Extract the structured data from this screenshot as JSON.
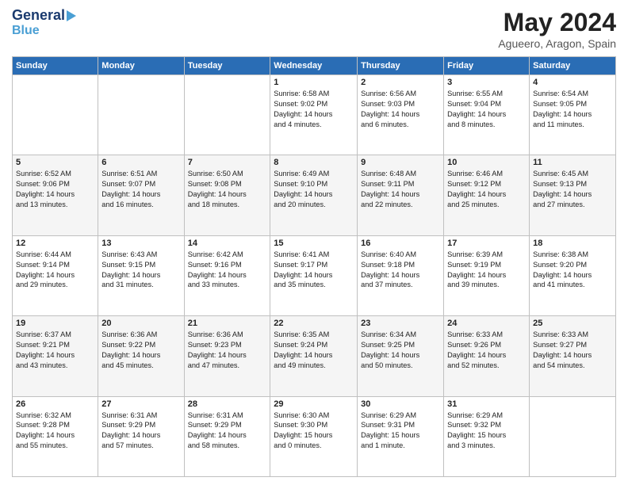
{
  "header": {
    "logo_line1": "General",
    "logo_line2": "Blue",
    "month": "May 2024",
    "location": "Agueero, Aragon, Spain"
  },
  "weekdays": [
    "Sunday",
    "Monday",
    "Tuesday",
    "Wednesday",
    "Thursday",
    "Friday",
    "Saturday"
  ],
  "weeks": [
    [
      {
        "day": "",
        "info": ""
      },
      {
        "day": "",
        "info": ""
      },
      {
        "day": "",
        "info": ""
      },
      {
        "day": "1",
        "info": "Sunrise: 6:58 AM\nSunset: 9:02 PM\nDaylight: 14 hours\nand 4 minutes."
      },
      {
        "day": "2",
        "info": "Sunrise: 6:56 AM\nSunset: 9:03 PM\nDaylight: 14 hours\nand 6 minutes."
      },
      {
        "day": "3",
        "info": "Sunrise: 6:55 AM\nSunset: 9:04 PM\nDaylight: 14 hours\nand 8 minutes."
      },
      {
        "day": "4",
        "info": "Sunrise: 6:54 AM\nSunset: 9:05 PM\nDaylight: 14 hours\nand 11 minutes."
      }
    ],
    [
      {
        "day": "5",
        "info": "Sunrise: 6:52 AM\nSunset: 9:06 PM\nDaylight: 14 hours\nand 13 minutes."
      },
      {
        "day": "6",
        "info": "Sunrise: 6:51 AM\nSunset: 9:07 PM\nDaylight: 14 hours\nand 16 minutes."
      },
      {
        "day": "7",
        "info": "Sunrise: 6:50 AM\nSunset: 9:08 PM\nDaylight: 14 hours\nand 18 minutes."
      },
      {
        "day": "8",
        "info": "Sunrise: 6:49 AM\nSunset: 9:10 PM\nDaylight: 14 hours\nand 20 minutes."
      },
      {
        "day": "9",
        "info": "Sunrise: 6:48 AM\nSunset: 9:11 PM\nDaylight: 14 hours\nand 22 minutes."
      },
      {
        "day": "10",
        "info": "Sunrise: 6:46 AM\nSunset: 9:12 PM\nDaylight: 14 hours\nand 25 minutes."
      },
      {
        "day": "11",
        "info": "Sunrise: 6:45 AM\nSunset: 9:13 PM\nDaylight: 14 hours\nand 27 minutes."
      }
    ],
    [
      {
        "day": "12",
        "info": "Sunrise: 6:44 AM\nSunset: 9:14 PM\nDaylight: 14 hours\nand 29 minutes."
      },
      {
        "day": "13",
        "info": "Sunrise: 6:43 AM\nSunset: 9:15 PM\nDaylight: 14 hours\nand 31 minutes."
      },
      {
        "day": "14",
        "info": "Sunrise: 6:42 AM\nSunset: 9:16 PM\nDaylight: 14 hours\nand 33 minutes."
      },
      {
        "day": "15",
        "info": "Sunrise: 6:41 AM\nSunset: 9:17 PM\nDaylight: 14 hours\nand 35 minutes."
      },
      {
        "day": "16",
        "info": "Sunrise: 6:40 AM\nSunset: 9:18 PM\nDaylight: 14 hours\nand 37 minutes."
      },
      {
        "day": "17",
        "info": "Sunrise: 6:39 AM\nSunset: 9:19 PM\nDaylight: 14 hours\nand 39 minutes."
      },
      {
        "day": "18",
        "info": "Sunrise: 6:38 AM\nSunset: 9:20 PM\nDaylight: 14 hours\nand 41 minutes."
      }
    ],
    [
      {
        "day": "19",
        "info": "Sunrise: 6:37 AM\nSunset: 9:21 PM\nDaylight: 14 hours\nand 43 minutes."
      },
      {
        "day": "20",
        "info": "Sunrise: 6:36 AM\nSunset: 9:22 PM\nDaylight: 14 hours\nand 45 minutes."
      },
      {
        "day": "21",
        "info": "Sunrise: 6:36 AM\nSunset: 9:23 PM\nDaylight: 14 hours\nand 47 minutes."
      },
      {
        "day": "22",
        "info": "Sunrise: 6:35 AM\nSunset: 9:24 PM\nDaylight: 14 hours\nand 49 minutes."
      },
      {
        "day": "23",
        "info": "Sunrise: 6:34 AM\nSunset: 9:25 PM\nDaylight: 14 hours\nand 50 minutes."
      },
      {
        "day": "24",
        "info": "Sunrise: 6:33 AM\nSunset: 9:26 PM\nDaylight: 14 hours\nand 52 minutes."
      },
      {
        "day": "25",
        "info": "Sunrise: 6:33 AM\nSunset: 9:27 PM\nDaylight: 14 hours\nand 54 minutes."
      }
    ],
    [
      {
        "day": "26",
        "info": "Sunrise: 6:32 AM\nSunset: 9:28 PM\nDaylight: 14 hours\nand 55 minutes."
      },
      {
        "day": "27",
        "info": "Sunrise: 6:31 AM\nSunset: 9:29 PM\nDaylight: 14 hours\nand 57 minutes."
      },
      {
        "day": "28",
        "info": "Sunrise: 6:31 AM\nSunset: 9:29 PM\nDaylight: 14 hours\nand 58 minutes."
      },
      {
        "day": "29",
        "info": "Sunrise: 6:30 AM\nSunset: 9:30 PM\nDaylight: 15 hours\nand 0 minutes."
      },
      {
        "day": "30",
        "info": "Sunrise: 6:29 AM\nSunset: 9:31 PM\nDaylight: 15 hours\nand 1 minute."
      },
      {
        "day": "31",
        "info": "Sunrise: 6:29 AM\nSunset: 9:32 PM\nDaylight: 15 hours\nand 3 minutes."
      },
      {
        "day": "",
        "info": ""
      }
    ]
  ]
}
